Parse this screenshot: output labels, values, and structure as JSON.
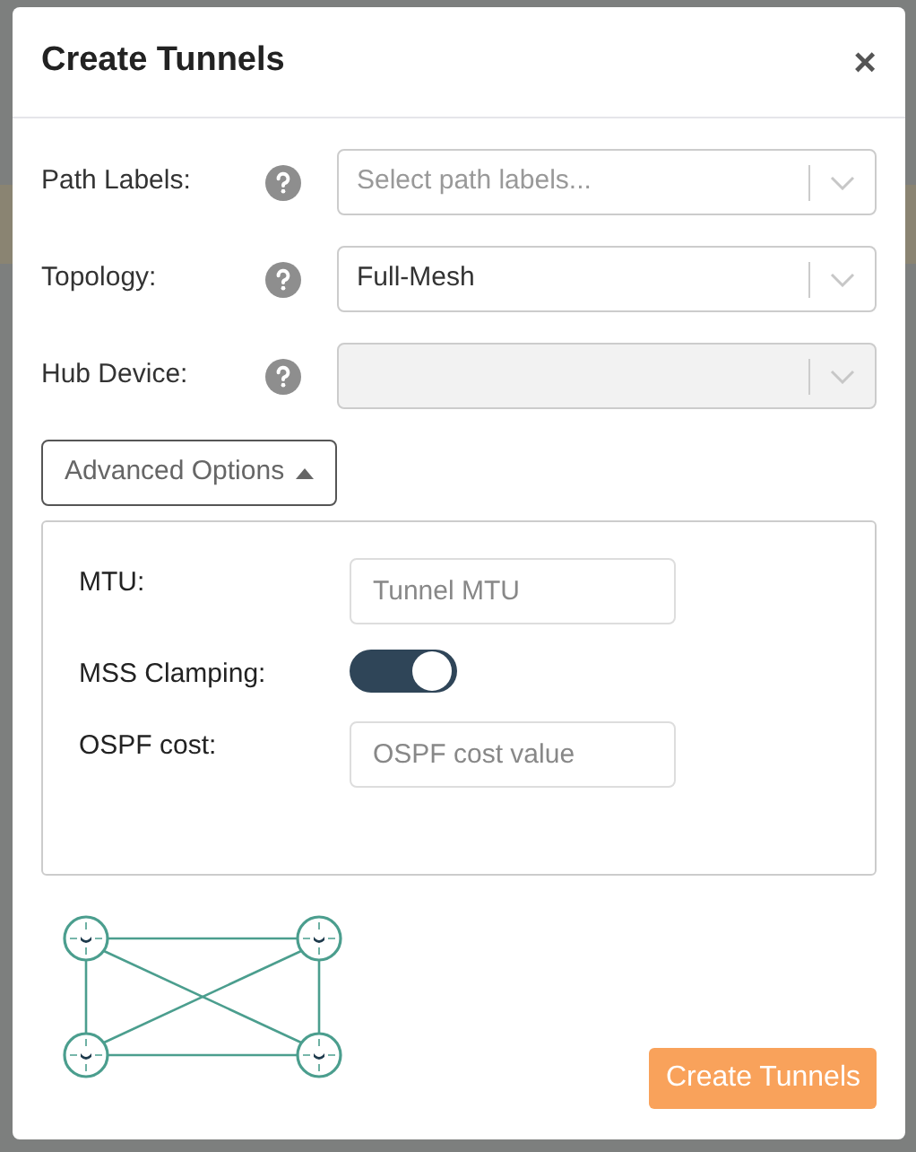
{
  "dialog": {
    "title": "Create Tunnels",
    "close": "×"
  },
  "fields": [
    {
      "label": "Path Labels:",
      "placeholder": "Select path labels...",
      "disabled": false
    },
    {
      "label": "Topology:",
      "value": "Full-Mesh",
      "disabled": false
    },
    {
      "label": "Hub Device:",
      "disabled": true
    }
  ],
  "advanced": {
    "label": "Advanced Options",
    "expanded": true,
    "fields": [
      {
        "kind": "input",
        "label": "MTU:",
        "placeholder": "Tunnel MTU"
      },
      {
        "kind": "toggle",
        "label": "MSS Clamping:",
        "on": true
      },
      {
        "kind": "input",
        "label": "OSPF cost:",
        "placeholder": "OSPF cost value"
      }
    ]
  },
  "submit": "Create Tunnels"
}
